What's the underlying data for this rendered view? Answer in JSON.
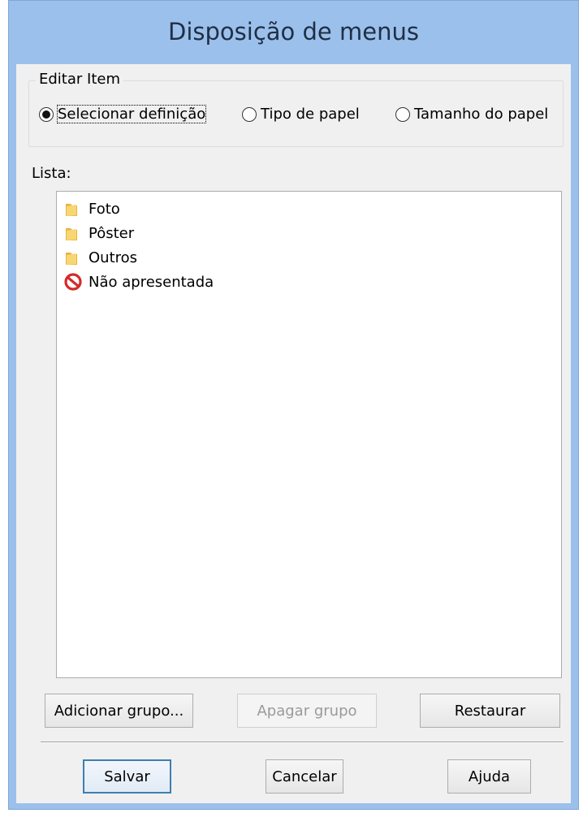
{
  "window": {
    "title": "Disposição de menus"
  },
  "edit_item": {
    "group_label": "Editar Item",
    "options": [
      {
        "label": "Selecionar definição",
        "selected": true
      },
      {
        "label": "Tipo de papel",
        "selected": false
      },
      {
        "label": "Tamanho do papel",
        "selected": false
      }
    ]
  },
  "list": {
    "label": "Lista:",
    "items": [
      {
        "label": "Foto",
        "icon": "folder-icon"
      },
      {
        "label": "Pôster",
        "icon": "folder-icon"
      },
      {
        "label": "Outros",
        "icon": "folder-icon"
      },
      {
        "label": "Não apresentada",
        "icon": "no-entry-icon"
      }
    ]
  },
  "actions": {
    "add_group": "Adicionar grupo...",
    "delete_group": "Apagar grupo",
    "restore": "Restaurar"
  },
  "footer": {
    "save": "Salvar",
    "cancel": "Cancelar",
    "help": "Ajuda"
  },
  "colors": {
    "titlebar": "#9cc0ec",
    "client": "#f0f0f0",
    "no_entry_red": "#d42a2a",
    "folder_yellow": "#f2c94c"
  }
}
